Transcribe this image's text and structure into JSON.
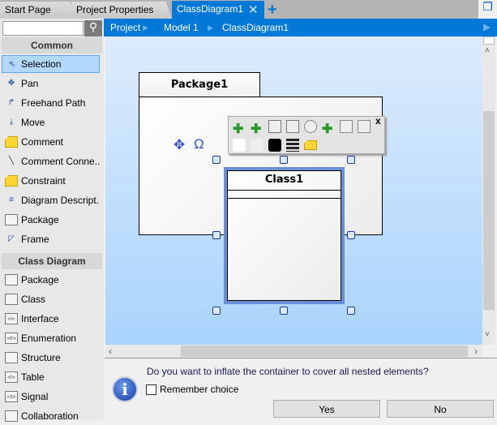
{
  "tabs": [
    {
      "label": "Start Page"
    },
    {
      "label": "Project Properties"
    },
    {
      "label": "ClassDiagram1",
      "active": true
    }
  ],
  "breadcrumb": [
    "Project",
    "Model 1",
    "ClassDiagram1"
  ],
  "search": {
    "value": "",
    "placeholder": ""
  },
  "toolbox": {
    "common_header": "Common",
    "common": [
      {
        "label": "Selection",
        "icon": "cursor-icon",
        "selected": true
      },
      {
        "label": "Pan",
        "icon": "pan-icon"
      },
      {
        "label": "Freehand Path",
        "icon": "freehand-icon"
      },
      {
        "label": "Move",
        "icon": "move-icon"
      },
      {
        "label": "Comment",
        "icon": "note-icon"
      },
      {
        "label": "Comment  Conne...",
        "icon": "line-icon"
      },
      {
        "label": "Constraint",
        "icon": "note-icon"
      },
      {
        "label": "Diagram Descript...",
        "icon": "lines-icon"
      },
      {
        "label": "Package",
        "icon": "package-icon"
      },
      {
        "label": "Frame",
        "icon": "frame-icon"
      }
    ],
    "class_header": "Class Diagram",
    "class": [
      {
        "label": "Package",
        "glyph": ""
      },
      {
        "label": "Class",
        "glyph": ""
      },
      {
        "label": "Interface",
        "glyph": "«i»"
      },
      {
        "label": "Enumeration",
        "glyph": "«e»"
      },
      {
        "label": "Structure",
        "glyph": ""
      },
      {
        "label": "Table",
        "glyph": "«t»"
      },
      {
        "label": "Signal",
        "glyph": "«s»"
      },
      {
        "label": "Collaboration",
        "glyph": ""
      }
    ]
  },
  "diagram": {
    "package_name": "Package1",
    "class_name": "Class1",
    "toolbar_close": "x"
  },
  "dialog": {
    "message": "Do you want to inflate the container to cover all nested elements?",
    "remember_label": "Remember choice",
    "remember_checked": false,
    "yes": "Yes",
    "no": "No"
  },
  "colors": {
    "accent": "#0078d7",
    "selection": "#b4d8fb"
  }
}
